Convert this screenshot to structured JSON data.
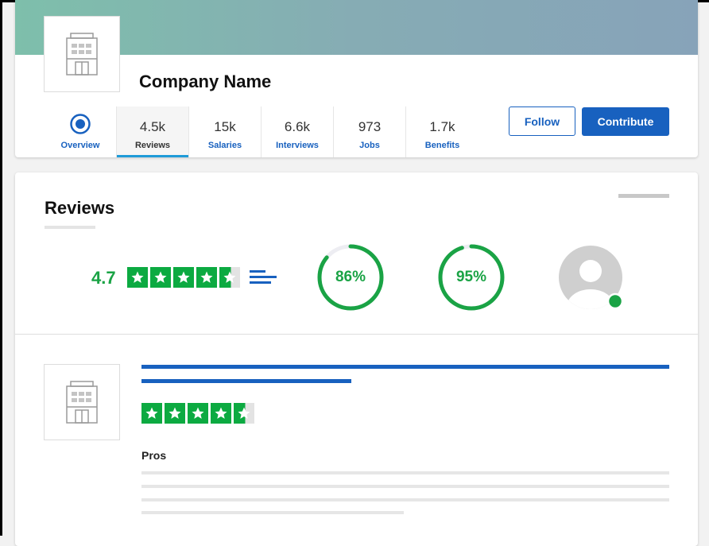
{
  "company": {
    "name": "Company Name"
  },
  "tabs": [
    {
      "count": "",
      "label": "Overview",
      "icon": "target-icon"
    },
    {
      "count": "4.5k",
      "label": "Reviews"
    },
    {
      "count": "15k",
      "label": "Salaries"
    },
    {
      "count": "6.6k",
      "label": "Interviews"
    },
    {
      "count": "973",
      "label": "Jobs"
    },
    {
      "count": "1.7k",
      "label": "Benefits"
    }
  ],
  "actions": {
    "follow": "Follow",
    "contribute": "Contribute"
  },
  "reviews": {
    "title": "Reviews",
    "rating": "4.7",
    "rating_value": 4.7,
    "recommend_percent": "86%",
    "recommend_value": 0.86,
    "approve_ceo_percent": "95%",
    "approve_ceo_value": 0.95,
    "review_item": {
      "stars": 4.5,
      "pros_label": "Pros"
    }
  },
  "colors": {
    "brand_blue": "#1861bf",
    "rating_green": "#0caa41",
    "active_tab_underline": "#1f9bd8",
    "online_dot": "#1aa345"
  }
}
